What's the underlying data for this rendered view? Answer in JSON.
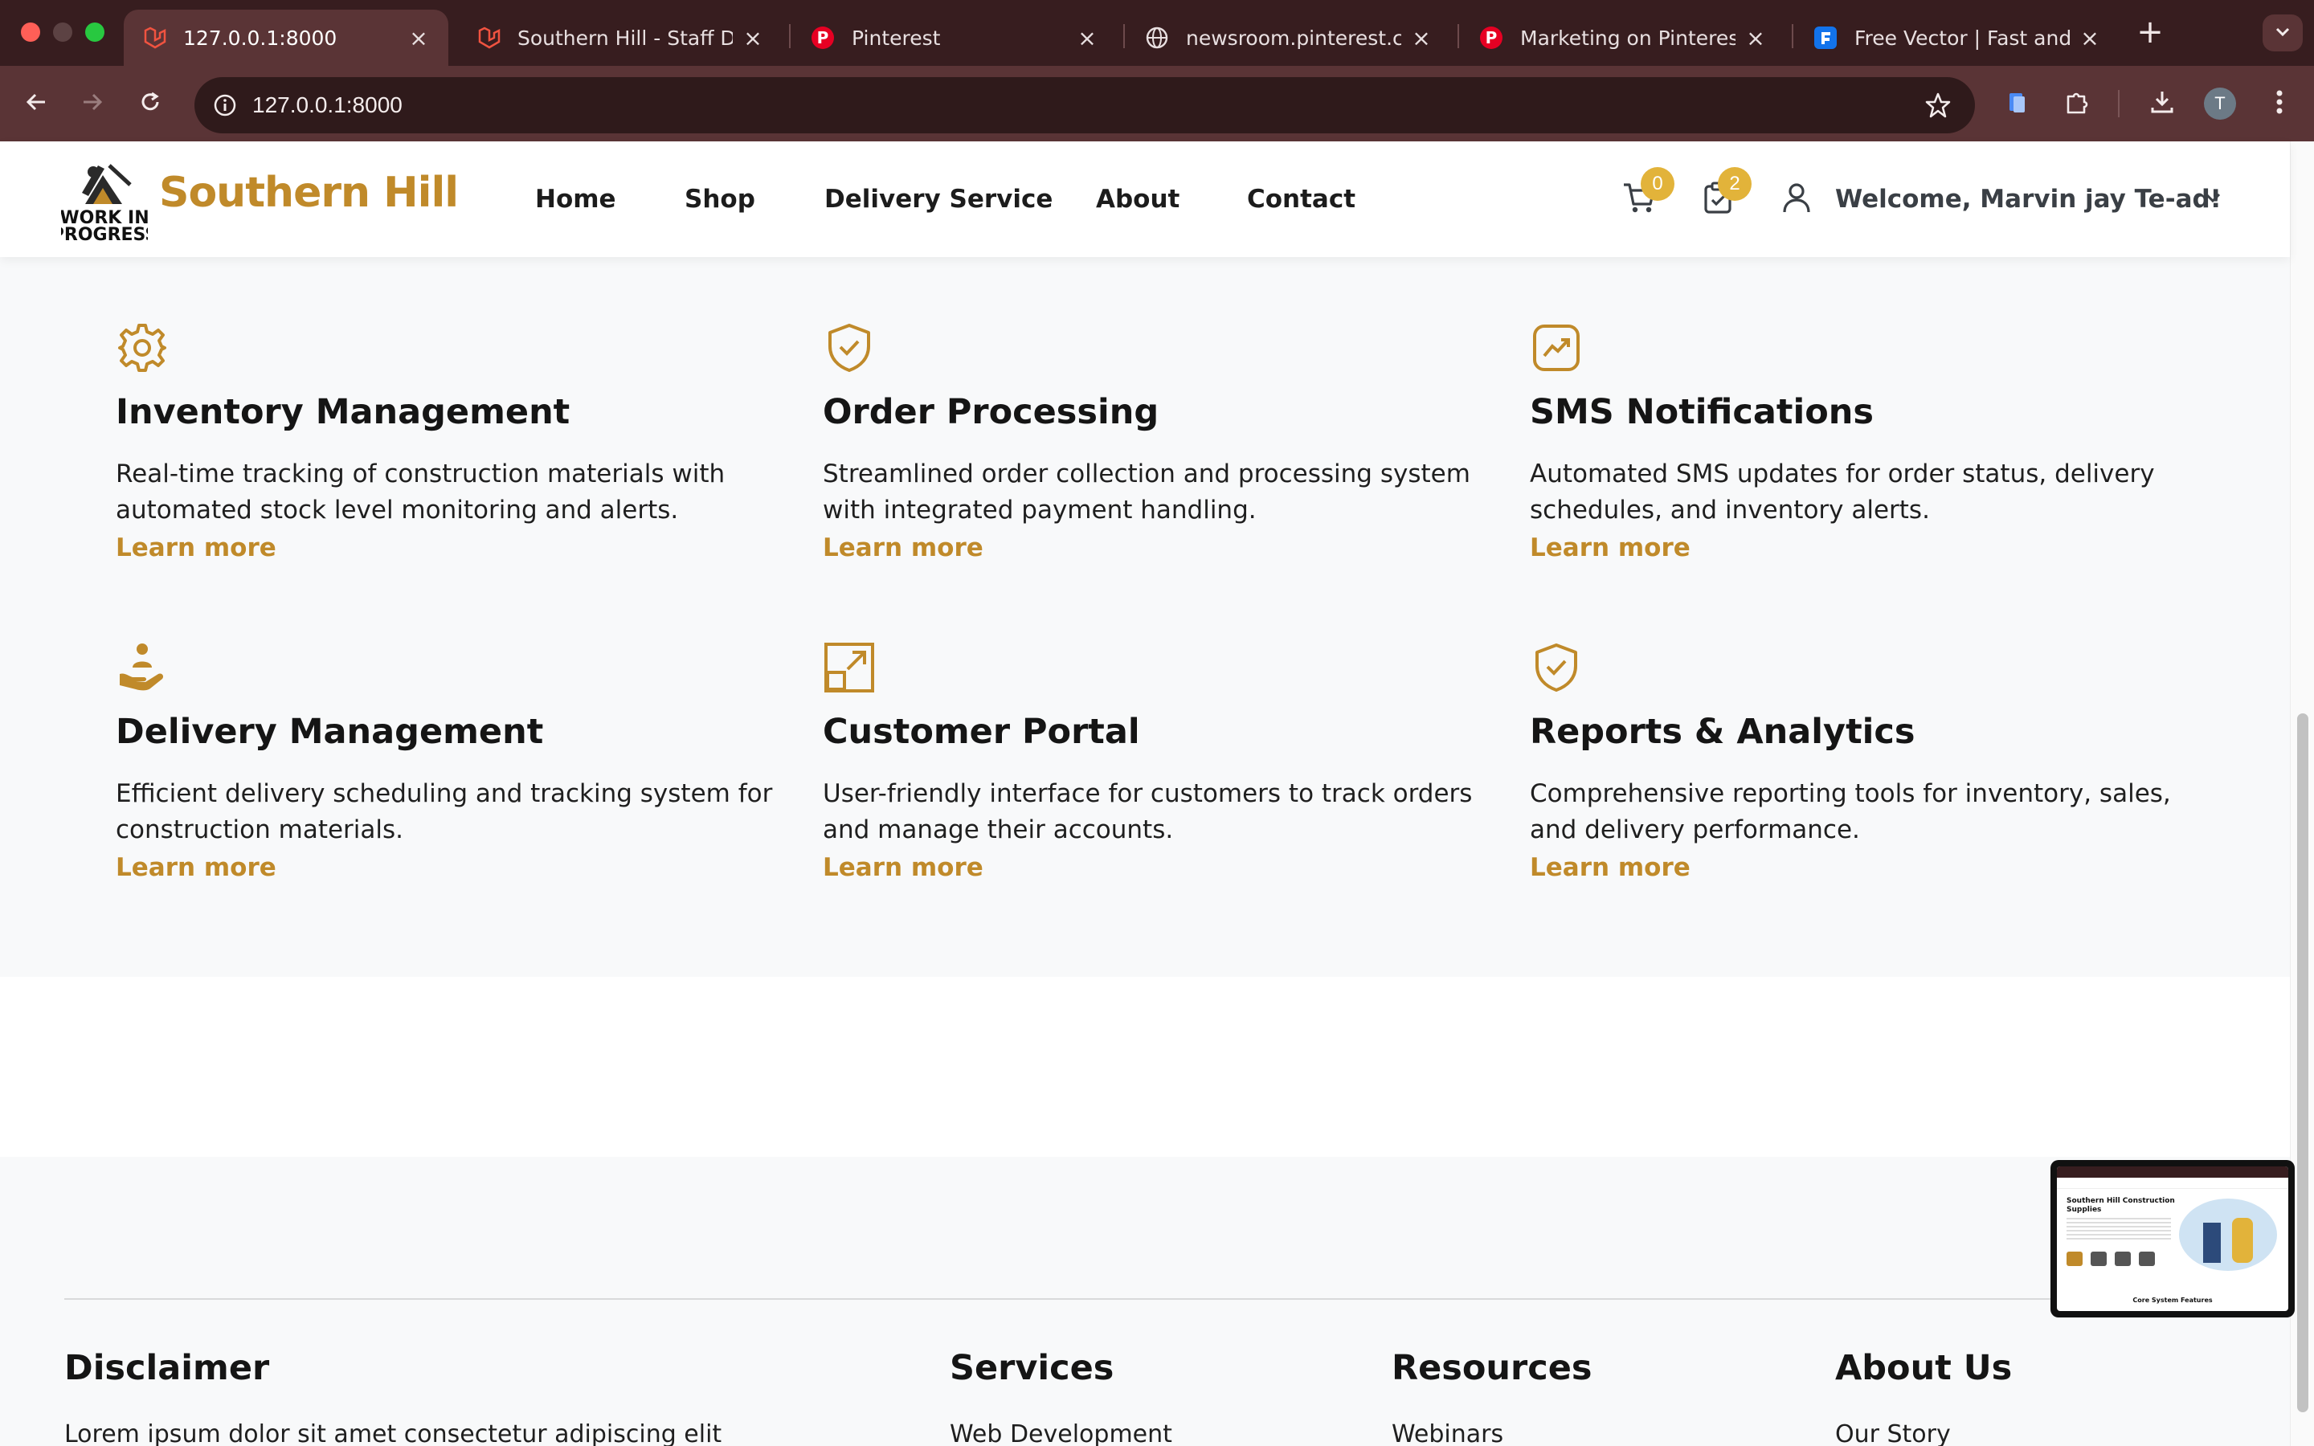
{
  "browser": {
    "tabs": [
      {
        "title": "127.0.0.1:8000",
        "icon": "laravel-icon",
        "active": true
      },
      {
        "title": "Southern Hill - Staff Das",
        "icon": "laravel-icon",
        "active": false
      },
      {
        "title": "Pinterest",
        "icon": "pinterest-icon",
        "active": false
      },
      {
        "title": "newsroom.pinterest.com",
        "icon": "globe-icon",
        "active": false
      },
      {
        "title": "Marketing on Pinterest |",
        "icon": "pinterest-icon",
        "active": false
      },
      {
        "title": "Free Vector | Fast and fr",
        "icon": "freepik-icon",
        "active": false
      }
    ],
    "new_tab": "+",
    "url": "127.0.0.1:8000",
    "profile_initial": "T"
  },
  "site": {
    "brand": "Southern Hill",
    "logo_lines": [
      "WORK IN",
      "PROGRESS"
    ],
    "nav": [
      "Home",
      "Shop",
      "Delivery Service",
      "About",
      "Contact"
    ],
    "cart_count": "0",
    "orders_count": "2",
    "welcome": "Welcome, Marvin jay Te-ad!"
  },
  "features": [
    {
      "icon": "gear-icon",
      "title": "Inventory Management",
      "description": "Real-time tracking of construction materials with automated stock level monitoring and alerts.",
      "link": "Learn more"
    },
    {
      "icon": "shield-check-icon",
      "title": "Order Processing",
      "description": "Streamlined order collection and processing system with integrated payment handling.",
      "link": "Learn more"
    },
    {
      "icon": "trending-up-icon",
      "title": "SMS Notifications",
      "description": "Automated SMS updates for order status, delivery schedules, and inventory alerts.",
      "link": "Learn more"
    },
    {
      "icon": "hand-person-icon",
      "title": "Delivery Management",
      "description": "Efficient delivery scheduling and tracking system for construction materials.",
      "link": "Learn more"
    },
    {
      "icon": "expand-icon",
      "title": "Customer Portal",
      "description": "User-friendly interface for customers to track orders and manage their accounts.",
      "link": "Learn more"
    },
    {
      "icon": "shield-check-icon",
      "title": "Reports & Analytics",
      "description": "Comprehensive reporting tools for inventory, sales, and delivery performance.",
      "link": "Learn more"
    }
  ],
  "footer": {
    "columns": [
      {
        "title": "Disclaimer",
        "first_item": "Lorem ipsum dolor sit amet consectetur adipiscing elit"
      },
      {
        "title": "Services",
        "first_item": "Web Development"
      },
      {
        "title": "Resources",
        "first_item": "Webinars"
      },
      {
        "title": "About Us",
        "first_item": "Our Story"
      }
    ]
  },
  "pip_preview": {
    "heading": "Southern Hill Construction Supplies",
    "caption": "Core System Features"
  },
  "colors": {
    "accent": "#c08a2a",
    "badge": "#e2b33a",
    "tab_strip": "#371d1f",
    "toolbar": "#5a3436"
  }
}
